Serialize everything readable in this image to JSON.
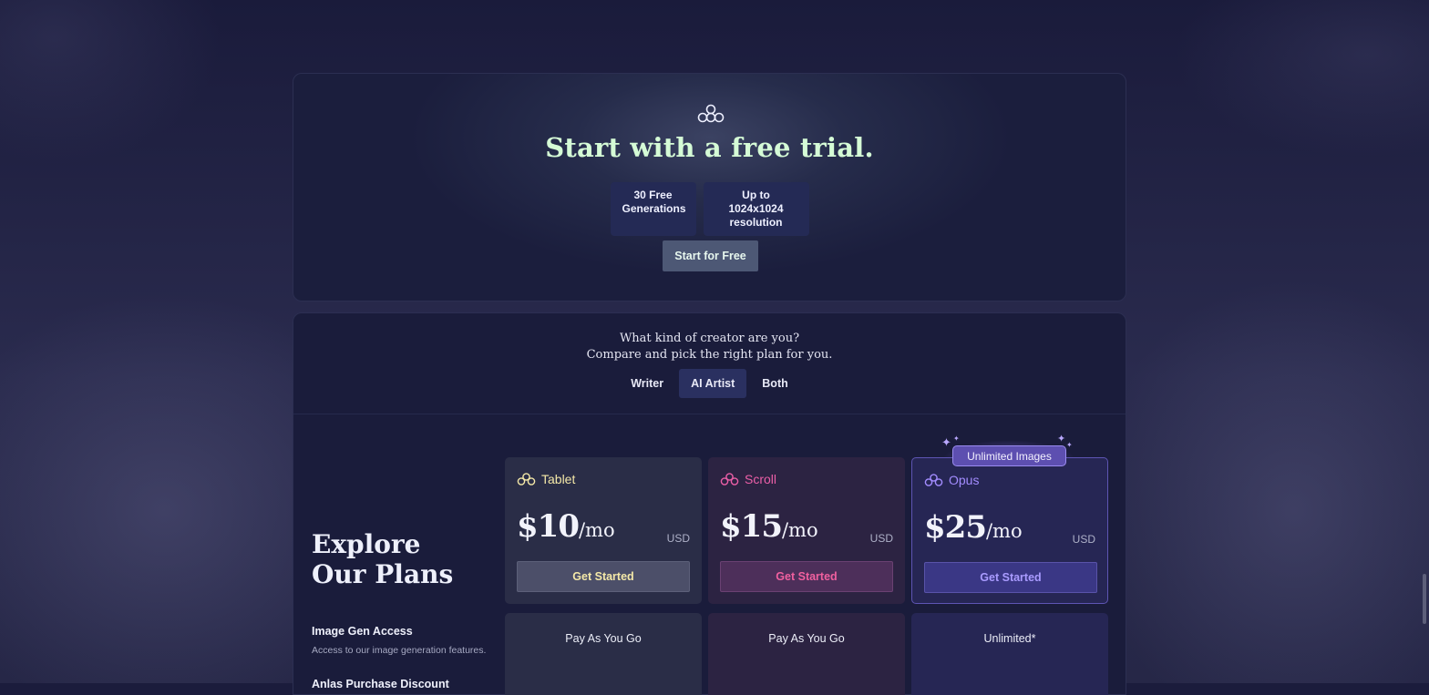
{
  "hero": {
    "title": "Start with a free trial.",
    "badges": [
      "30 Free Generations",
      "Up to 1024x1024 resolution"
    ],
    "badge_lines": [
      [
        "30 Free",
        "Generations"
      ],
      [
        "Up to 1024x1024",
        "resolution"
      ]
    ],
    "cta": "Start for Free",
    "logo_icon": "three-circles-logo-icon"
  },
  "plans": {
    "question_line1": "What kind of creator are you?",
    "question_line2": "Compare and pick the right plan for you.",
    "tabs": [
      "Writer",
      "AI Artist",
      "Both"
    ],
    "active_tab": "AI Artist",
    "heading_line1": "Explore",
    "heading_line2": "Our Plans",
    "feature": {
      "title": "Image Gen Access",
      "description": "Access to our image generation features.",
      "next_title_partial": "Anlas Purchase Discount"
    },
    "tiers": [
      {
        "name": "Tablet",
        "price": "$10",
        "period": "/mo",
        "currency": "USD",
        "cta": "Get Started",
        "image_gen": "Pay As You Go",
        "accent": "#f4e8a8"
      },
      {
        "name": "Scroll",
        "price": "$15",
        "period": "/mo",
        "currency": "USD",
        "cta": "Get Started",
        "image_gen": "Pay As You Go",
        "accent": "#ec5fa8"
      },
      {
        "name": "Opus",
        "price": "$25",
        "period": "/mo",
        "currency": "USD",
        "cta": "Get Started",
        "image_gen": "Unlimited*",
        "accent": "#a38cff",
        "badge": "Unlimited Images"
      }
    ]
  },
  "colors": {
    "background": "#1b1c3c",
    "hero_title": "#d5fbd6"
  }
}
